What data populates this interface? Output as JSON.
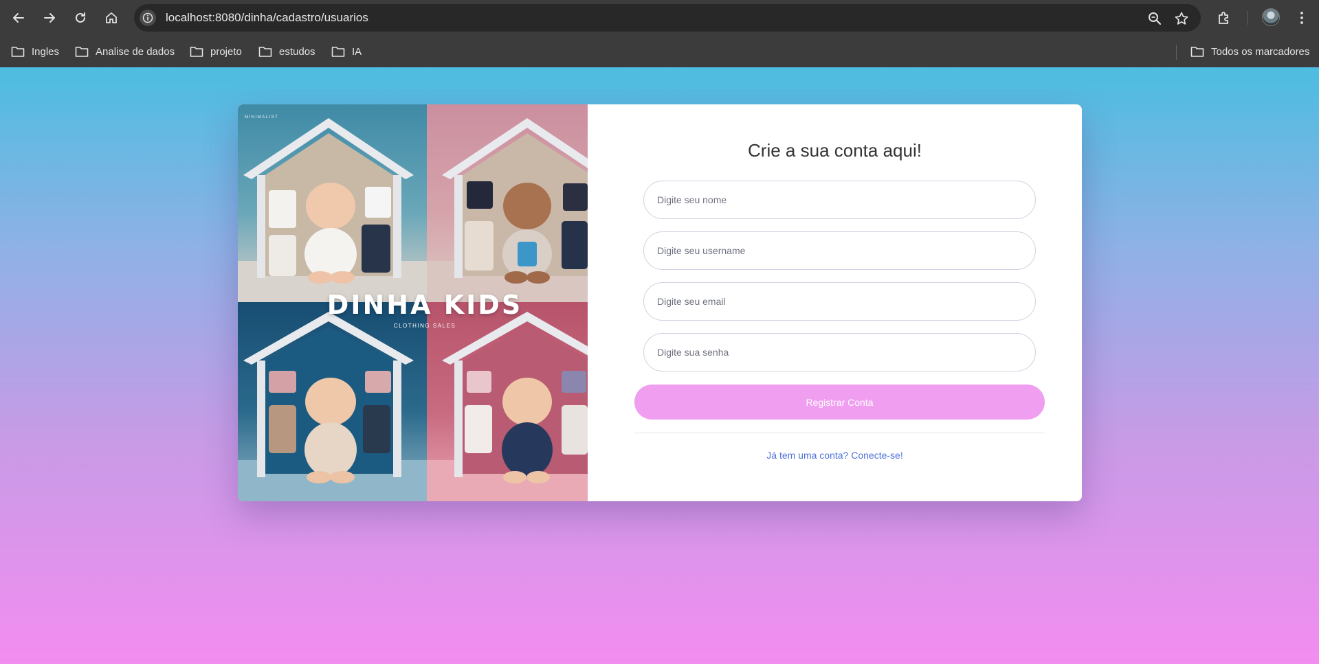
{
  "browser": {
    "url": "localhost:8080/dinha/cadastro/usuarios",
    "bookmarks": [
      "Ingles",
      "Analise de dados",
      "projeto",
      "estudos",
      "IA"
    ],
    "all_bookmarks_label": "Todos os marcadores"
  },
  "hero": {
    "brand_small": "MINIMALIST",
    "title": "DINHA KIDS",
    "subtitle": "CLOTHING SALES"
  },
  "form": {
    "title": "Crie a sua conta aqui!",
    "name_placeholder": "Digite seu nome",
    "username_placeholder": "Digite seu username",
    "email_placeholder": "Digite seu email",
    "password_placeholder": "Digite sua senha",
    "register_label": "Registrar Conta",
    "login_link": "Já tem uma conta? Conecte-se!"
  },
  "colors": {
    "button": "#f09ef0",
    "link": "#4e72d8",
    "gradient_top": "#4cbde0",
    "gradient_bottom": "#f38df0"
  }
}
